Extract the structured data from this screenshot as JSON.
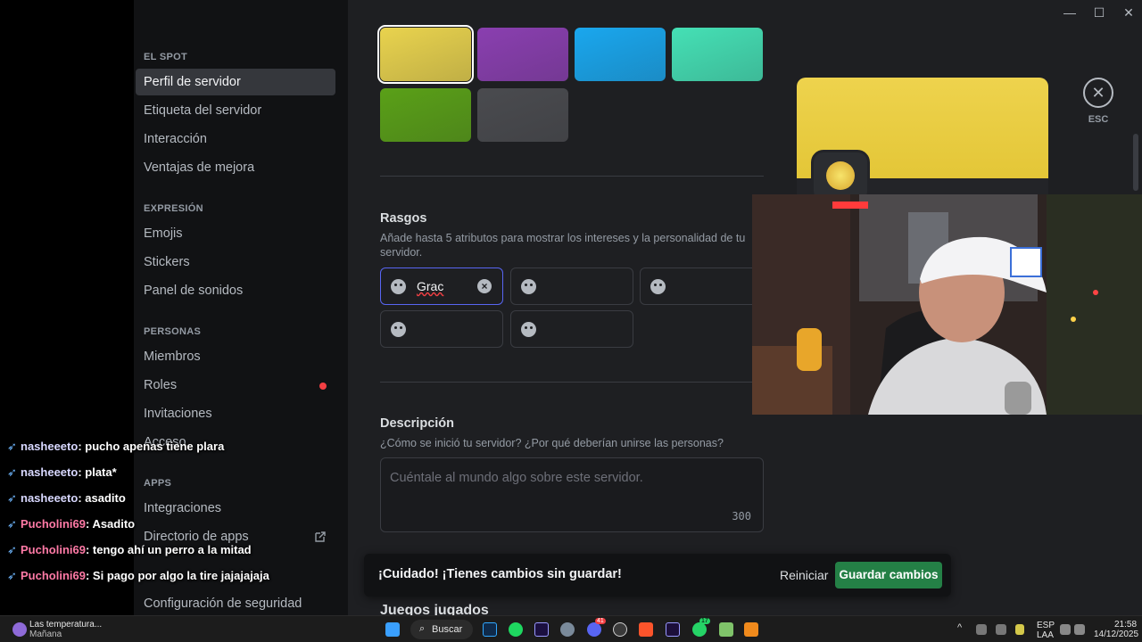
{
  "window": {
    "minimize": "—",
    "maximize": "☐",
    "close": "✕"
  },
  "sidebar": {
    "sections": [
      {
        "title": "EL SPOT",
        "items": [
          "Perfil de servidor",
          "Etiqueta del servidor",
          "Interacción",
          "Ventajas de mejora"
        ]
      },
      {
        "title": "EXPRESIÓN",
        "items": [
          "Emojis",
          "Stickers",
          "Panel de sonidos"
        ]
      },
      {
        "title": "PERSONAS",
        "items": [
          "Miembros",
          "Roles",
          "Invitaciones",
          "Acceso"
        ]
      },
      {
        "title": "APPS",
        "items": [
          "Integraciones",
          "Directorio de apps"
        ]
      },
      {
        "title": "",
        "items": [
          "Configuración de seguridad"
        ]
      }
    ],
    "active_item": "Perfil de servidor"
  },
  "colors": {
    "swatches": [
      "#e9d34e",
      "#8a3fb0",
      "#1aa7ee",
      "#45e0b5",
      "#5aa018",
      "#4a4b4f"
    ],
    "accent": "#5865f2",
    "save_button": "#248046"
  },
  "traits": {
    "title": "Rasgos",
    "description": "Añade hasta 5 atributos para mostrar los intereses y la personalidad de tu servidor.",
    "active_value": "Grac",
    "slots": 5
  },
  "description": {
    "title": "Descripción",
    "subtitle": "¿Cómo se inició tu servidor? ¿Por qué deberían unirse las personas?",
    "placeholder": "Cuéntale al mundo algo sobre este servidor.",
    "counter": "300"
  },
  "next_section": "Juegos jugados",
  "preview": {
    "esc_label": "ESC"
  },
  "unsaved_bar": {
    "message": "¡Cuidado! ¡Tienes cambios sin guardar!",
    "reset_label": "Reiniciar",
    "save_label": "Guardar cambios"
  },
  "chat": [
    {
      "user": "nasheeeto",
      "text": "pucho apenas tiene plara"
    },
    {
      "user": "nasheeeto",
      "text": "plata*"
    },
    {
      "user": "nasheeeto",
      "text": "asadito"
    },
    {
      "user": "Pucholini69",
      "text": "Asadito"
    },
    {
      "user": "Pucholini69",
      "text": "tengo ahí un perro a la mitad"
    },
    {
      "user": "Pucholini69",
      "text": "Si pago por algo la tire jajajajaja"
    }
  ],
  "taskbar": {
    "weather_title": "Las temperatura...",
    "weather_sub": "Mañana",
    "search_label": "Buscar",
    "lang_top": "ESP",
    "lang_bottom": "LAA",
    "time": "21:58",
    "date": "14/12/2025",
    "badge_discord": "41",
    "badge_whatsapp": "17",
    "icons": [
      "windows-icon",
      "photoshop-icon",
      "spotify-icon",
      "after-effects-icon",
      "settings-icon",
      "discord-icon",
      "obs-icon",
      "brave-icon",
      "premiere-icon",
      "whatsapp-icon",
      "notepad-icon",
      "fl-studio-icon"
    ]
  }
}
